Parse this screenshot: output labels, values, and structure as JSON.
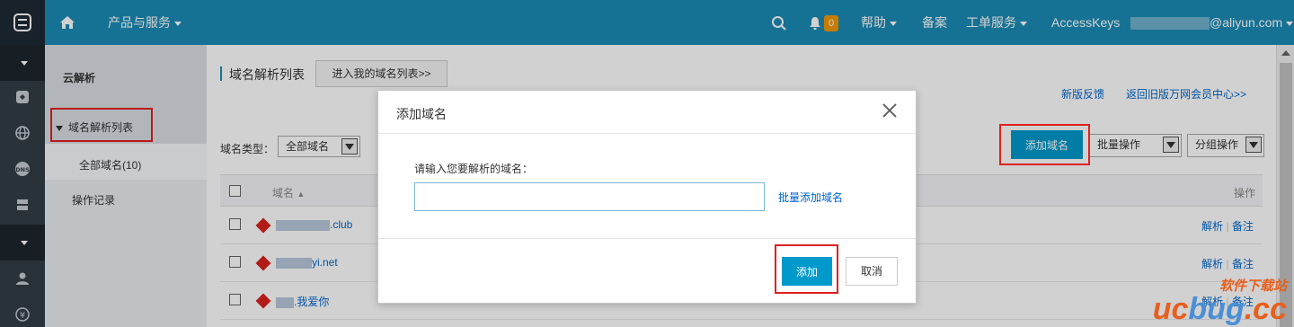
{
  "topbar": {
    "products_label": "产品与服务",
    "notification_count": "0",
    "help_label": "帮助",
    "beian_label": "备案",
    "ticket_label": "工单服务",
    "accesskeys_label": "AccessKeys",
    "account_suffix": "@aliyun.com"
  },
  "sidebar": {
    "title": "云解析",
    "items": [
      {
        "label": "域名解析列表"
      },
      {
        "label": "全部域名(10)"
      },
      {
        "label": "操作记录"
      }
    ]
  },
  "main": {
    "title": "域名解析列表",
    "goto_button": "进入我的域名列表>>",
    "feedback_link": "新版反馈",
    "back_link": "返回旧版万网会员中心>>",
    "filter_label": "域名类型：",
    "filter_value": "全部域名",
    "add_domain_button": "添加域名",
    "batch_select": "批量操作",
    "group_select": "分组操作",
    "table": {
      "col_domain": "域名",
      "col_action": "操作",
      "rows": [
        {
          "domain_suffix": ".club",
          "action_resolve": "解析",
          "action_note": "备注"
        },
        {
          "domain_suffix": "yi.net",
          "action_resolve": "解析",
          "action_note": "备注"
        },
        {
          "domain_suffix": ".我爱你",
          "action_resolve": "解析",
          "action_note": "备注"
        }
      ]
    }
  },
  "modal": {
    "title": "添加域名",
    "prompt": "请输入您要解析的域名：",
    "input_value": "",
    "batch_link": "批量添加域名",
    "confirm_button": "添加",
    "cancel_button": "取消"
  },
  "watermark": {
    "small": "软件下载站",
    "big": "ucbug.cc"
  },
  "colors": {
    "topbar": "#1b8bb5",
    "primary": "#0099cc",
    "highlight_box": "#e02020"
  }
}
